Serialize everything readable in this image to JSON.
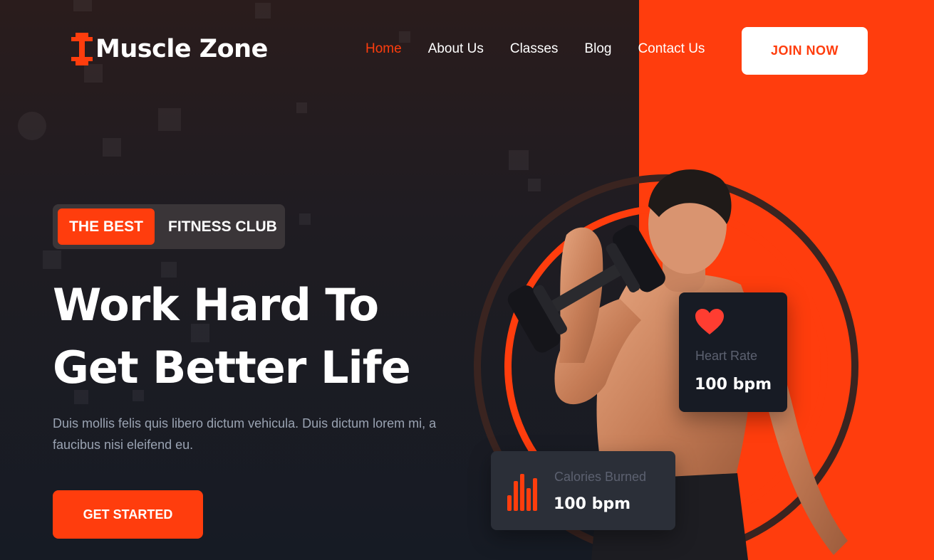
{
  "brand": {
    "name": "Muscle Zone",
    "accent_color": "#ff3d0d",
    "icon": "dumbbell-icon"
  },
  "nav": {
    "items": [
      {
        "label": "Home",
        "active": true
      },
      {
        "label": "About Us",
        "active": false
      },
      {
        "label": "Classes",
        "active": false
      },
      {
        "label": "Blog",
        "active": false
      },
      {
        "label": "Contact Us",
        "active": false
      }
    ],
    "join_label": "JOIN NOW"
  },
  "hero": {
    "badge_highlight": "THE BEST",
    "badge_rest": "FITNESS CLUB",
    "headline_line1": "Work Hard To",
    "headline_line2": "Get Better Life",
    "description": "Duis mollis felis quis libero dictum vehicula. Duis dictum lorem mi, a faucibus nisi eleifend eu.",
    "cta_label": "GET STARTED"
  },
  "stats": {
    "heart": {
      "icon": "heart-icon",
      "label": "Heart Rate",
      "value": "100 bpm"
    },
    "calories": {
      "icon": "bar-chart-icon",
      "label": "Calories Burned",
      "value": "100 bpm"
    }
  }
}
